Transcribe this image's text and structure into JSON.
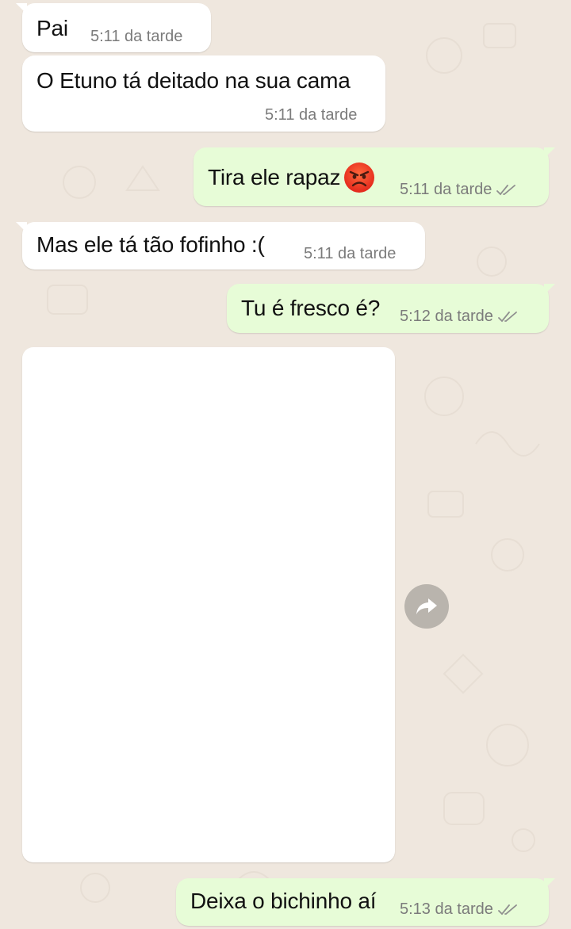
{
  "chat": {
    "messages": [
      {
        "direction": "incoming",
        "text": "Pai",
        "time": "5:11 da tarde"
      },
      {
        "direction": "incoming",
        "text": "O Etuno tá deitado na sua cama",
        "time": "5:11 da tarde"
      },
      {
        "direction": "outgoing",
        "text": "Tira ele rapaz",
        "emoji": "angry-face-emoji",
        "time": "5:11 da tarde",
        "status": "read-double-check"
      },
      {
        "direction": "incoming",
        "text": "Mas ele tá tão fofinho :(",
        "time": "5:11 da tarde"
      },
      {
        "direction": "outgoing",
        "text": "Tu é fresco é?",
        "time": "5:12 da tarde",
        "status": "read-double-check"
      },
      {
        "direction": "incoming",
        "type": "image",
        "icon": "forward-icon"
      },
      {
        "direction": "outgoing",
        "text": "Deixa o bichinho aí",
        "time": "5:13 da tarde",
        "status": "read-double-check"
      }
    ]
  },
  "colors": {
    "background": "#efe7de",
    "incoming_bubble": "#ffffff",
    "outgoing_bubble": "#e7fcd7",
    "timestamp": "#7b7b7b",
    "forward_button": "#b9b4ad"
  }
}
